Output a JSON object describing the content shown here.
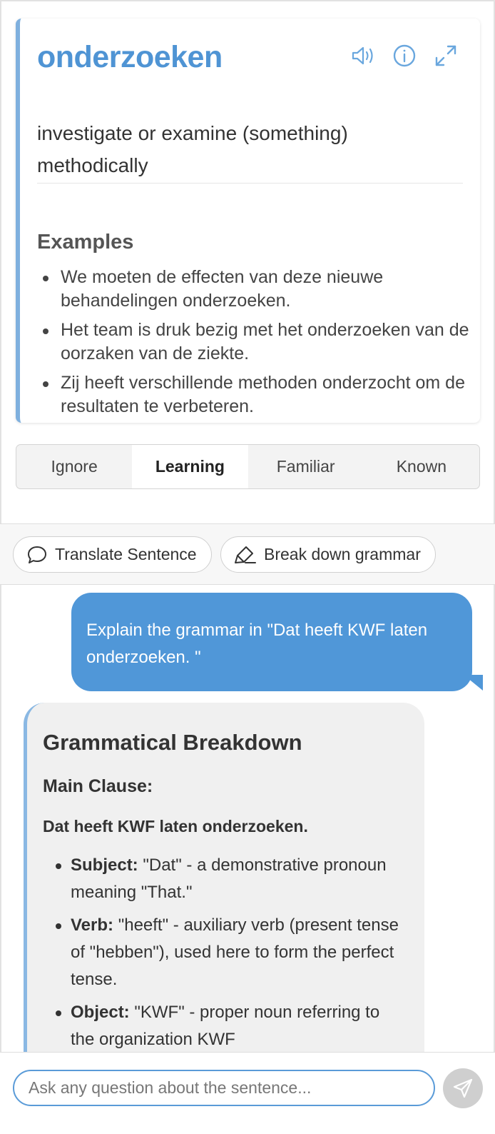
{
  "word_card": {
    "word": "onderzoeken",
    "definition": "investigate or examine (something) methodically",
    "examples_title": "Examples",
    "examples": [
      "We moeten de effecten van deze nieuwe behandelingen onderzoeken.",
      "Het team is druk bezig met het onderzoeken van de oorzaken van de ziekte.",
      "Zij heeft verschillende methoden onderzocht om de resultaten te verbeteren."
    ],
    "icons": [
      "speaker-icon",
      "info-icon",
      "expand-icon"
    ]
  },
  "status_options": [
    "Ignore",
    "Learning",
    "Familiar",
    "Known"
  ],
  "status_selected": "Learning",
  "actions": {
    "translate_label": "Translate Sentence",
    "grammar_label": "Break down grammar"
  },
  "chat": {
    "user_message": "Explain the grammar in \"Dat heeft KWF laten onderzoeken. \"",
    "assistant": {
      "heading": "Grammatical Breakdown",
      "subheading": "Main Clause:",
      "sentence": "Dat heeft KWF laten onderzoeken.",
      "items": [
        {
          "term": "Subject:",
          "text": " \"Dat\" - a demonstrative pronoun meaning \"That.\""
        },
        {
          "term": "Verb:",
          "text": " \"heeft\" - auxiliary verb (present tense of \"hebben\"), used here to form the perfect tense."
        },
        {
          "term": "Object:",
          "text": " \"KWF\" - proper noun referring to the organization KWF"
        }
      ]
    }
  },
  "input": {
    "placeholder": "Ask any question about the sentence..."
  },
  "colors": {
    "accent": "#4f94d4",
    "user_bubble": "#5097d8",
    "card_border": "#7fb0de",
    "send_button": "#cfcfcf"
  }
}
